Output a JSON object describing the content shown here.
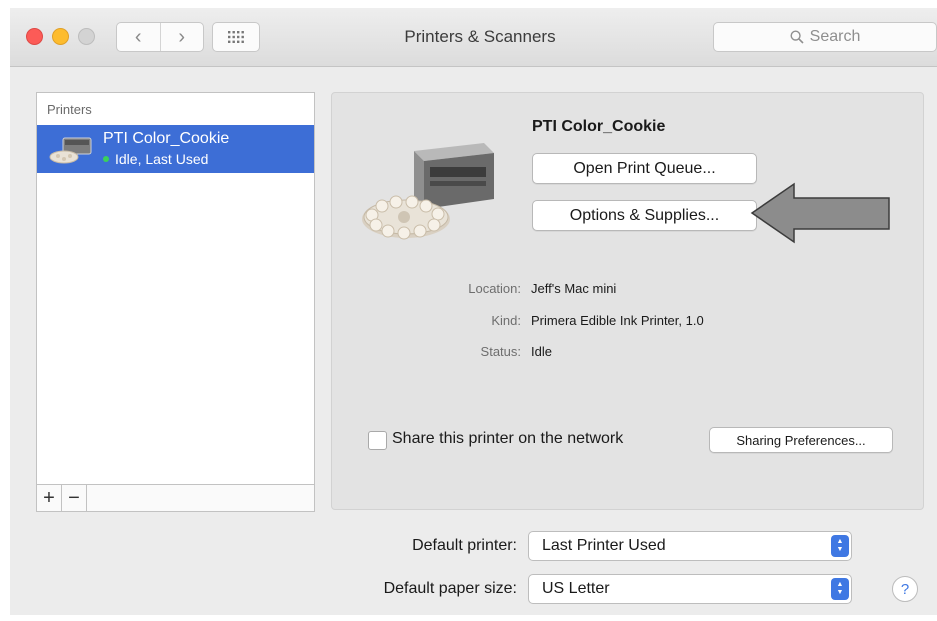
{
  "window": {
    "title": "Printers & Scanners",
    "search_placeholder": "Search",
    "nav_back": "‹",
    "nav_forward": "›"
  },
  "printers_list": {
    "header": "Printers",
    "items": [
      {
        "name": "PTI Color_Cookie",
        "status": "Idle, Last Used",
        "status_color": "#3ad15a",
        "selected": true
      }
    ],
    "add_label": "+",
    "remove_label": "−"
  },
  "detail": {
    "printer_name": "PTI Color_Cookie",
    "open_queue_label": "Open Print Queue...",
    "options_label": "Options & Supplies...",
    "info": [
      {
        "label": "Location:",
        "value": "Jeff's Mac mini"
      },
      {
        "label": "Kind:",
        "value": "Primera Edible Ink Printer, 1.0"
      },
      {
        "label": "Status:",
        "value": "Idle"
      }
    ],
    "share_label": "Share this printer on the network",
    "share_checked": false,
    "sharing_prefs_label": "Sharing Preferences..."
  },
  "defaults": {
    "printer_label": "Default printer:",
    "printer_value": "Last Printer Used",
    "paper_label": "Default paper size:",
    "paper_value": "US Letter"
  },
  "help_label": "?",
  "colors": {
    "selection": "#3d6ed6",
    "accent": "#3f78e3",
    "annotation_arrow": "#8c8c8c"
  }
}
